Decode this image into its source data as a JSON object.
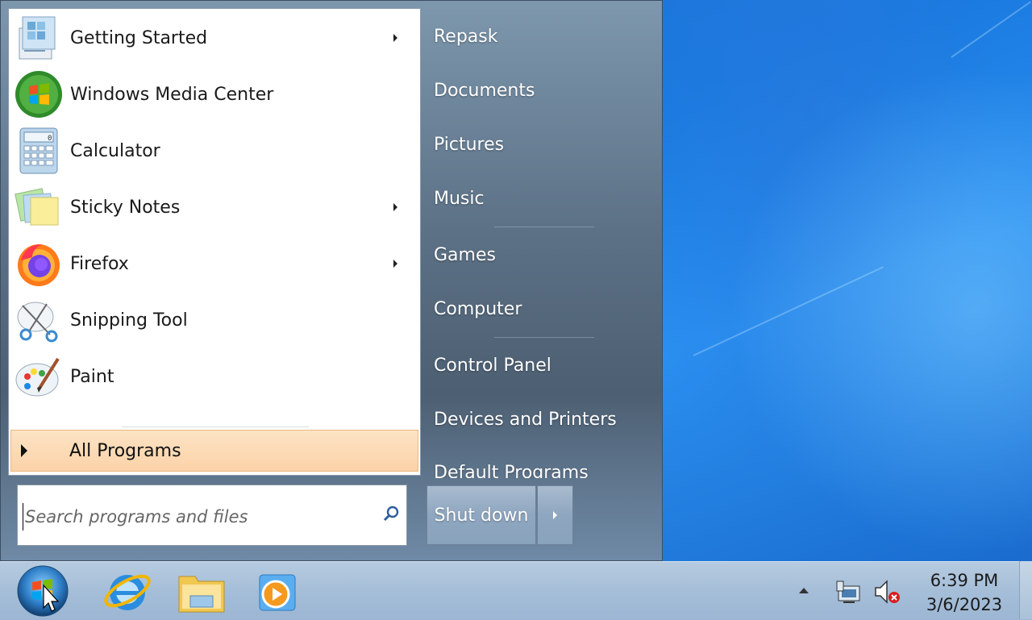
{
  "start_menu": {
    "programs": [
      {
        "label": "Getting Started",
        "icon": "getting-started-icon",
        "has_submenu": true
      },
      {
        "label": "Windows Media Center",
        "icon": "media-center-icon",
        "has_submenu": false
      },
      {
        "label": "Calculator",
        "icon": "calculator-icon",
        "has_submenu": false
      },
      {
        "label": "Sticky Notes",
        "icon": "sticky-notes-icon",
        "has_submenu": true
      },
      {
        "label": "Firefox",
        "icon": "firefox-icon",
        "has_submenu": true
      },
      {
        "label": "Snipping Tool",
        "icon": "snipping-tool-icon",
        "has_submenu": false
      },
      {
        "label": "Paint",
        "icon": "paint-icon",
        "has_submenu": false
      }
    ],
    "all_programs_label": "All Programs",
    "search": {
      "placeholder": "Search programs and files",
      "value": ""
    },
    "right_items": [
      "Repask",
      "Documents",
      "Pictures",
      "Music",
      "Games",
      "Computer",
      "Control Panel",
      "Devices and Printers",
      "Default Programs"
    ],
    "shutdown_label": "Shut down"
  },
  "taskbar": {
    "pinned": [
      "internet-explorer-icon",
      "windows-explorer-icon",
      "media-player-icon"
    ],
    "tray_icons": [
      "network-icon",
      "volume-muted-icon"
    ],
    "clock_time": "6:39 PM",
    "clock_date": "3/6/2023"
  },
  "colors": {
    "highlight": "#fbd2a8",
    "desktop": "#1a7ae0",
    "taskbar": "#a5bed8"
  }
}
